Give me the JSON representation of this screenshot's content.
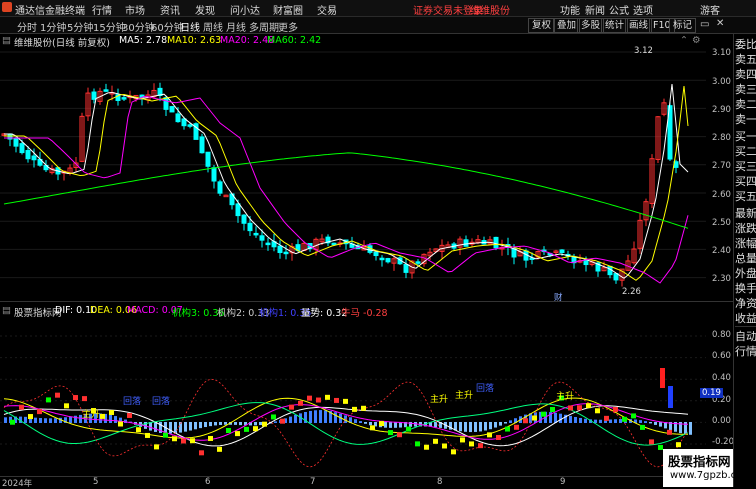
{
  "menubar": {
    "app_title": "通达信金融终端",
    "items": [
      "行情",
      "市场",
      "资讯",
      "发现",
      "问小达",
      "财富圈",
      "交易"
    ],
    "notice": "证券交易未登录",
    "stock": "维维股份",
    "right_items": [
      "功能",
      "新闻",
      "公式",
      "选项"
    ],
    "user": "游客"
  },
  "tabbar": {
    "periods": [
      "分时",
      "1分钟",
      "5分钟",
      "15分钟",
      "30分钟",
      "60分钟",
      "日线",
      "周线",
      "月线",
      "多周期",
      "更多"
    ],
    "active_period": "日线",
    "buttons": [
      "复权",
      "叠加",
      "多股",
      "统计",
      "画线",
      "F10",
      "标记"
    ]
  },
  "main_chart": {
    "title": "维维股份(日线 前复权)",
    "ma5_label": "MA5: 2.78",
    "ma10_label": "MA10: 2.63",
    "ma20_label": "MA20: 2.48",
    "ma60_label": "MA60: 2.42",
    "y_ticks": [
      "3.10",
      "3.00",
      "2.90",
      "2.80",
      "2.70",
      "2.60",
      "2.50",
      "2.40",
      "2.30"
    ],
    "high_label": "3.12",
    "low_label": "2.26",
    "event_marker": "财"
  },
  "sub_chart": {
    "title": "股票指标网",
    "dif_label": "DIF: 0.10",
    "dea_label": "DEA: 0.06",
    "macd_label": "MACD: 0.07",
    "jg3_label": "机构3: 0.36",
    "jg2_label": "机构2: 0.33",
    "jg1_label": "机构1: 0.35",
    "lianshi_label": "量势: 0.32",
    "niuma_label": "牛马 -0.28",
    "y_ticks": [
      "0.80",
      "0.60",
      "0.40",
      "0.20",
      "0.00",
      "-0.20"
    ],
    "current_label": "0.19",
    "annotations": [
      "主升",
      "主升",
      "主升",
      "主升",
      "回落",
      "回落",
      "回落"
    ]
  },
  "x_axis": {
    "labels": [
      "2024年",
      "5",
      "6",
      "7",
      "8",
      "9"
    ]
  },
  "right_panel": {
    "items": [
      "委比",
      "卖五",
      "卖四",
      "卖三",
      "卖二",
      "卖一",
      "买一",
      "买二",
      "买三",
      "买四",
      "买五",
      "最新",
      "涨跌",
      "涨幅",
      "总量",
      "外盘",
      "换手",
      "净资",
      "收益"
    ],
    "bottom_items": [
      "自动",
      "行情"
    ]
  },
  "watermark": {
    "line1": "股票指标网",
    "line2": "www.7gpzb.com"
  },
  "colors": {
    "up": "#ff3030",
    "down": "#00ffff",
    "ma5": "#ffffff",
    "ma10": "#ffff00",
    "ma20": "#ff00ff",
    "ma60": "#00ff00"
  }
}
